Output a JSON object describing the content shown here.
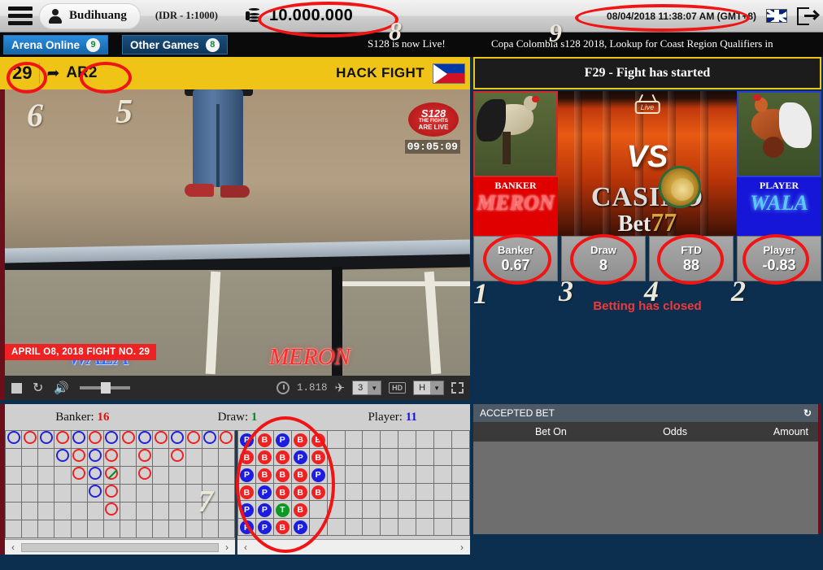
{
  "topbar": {
    "menu_icon": "hamburger-icon",
    "username": "Budihuang",
    "currency": "(IDR - 1:1000)",
    "balance": "10.000.000",
    "timestamp": "08/04/2018 11:38:07 AM (GMT+8)",
    "flag_icon": "uk-flag-icon",
    "logout_icon": "logout-icon"
  },
  "nav": {
    "tabs": [
      {
        "label": "Arena Online",
        "count": "9"
      },
      {
        "label": "Other Games",
        "count": "8"
      }
    ],
    "ticker_left": "S128 is now Live!",
    "ticker_right": "Copa Colombia s128 2018, Lookup for Coast Region Qualifiers in"
  },
  "fight_header": {
    "fight_number": "29",
    "rooster_icon": "rooster-icon",
    "arena_code": "AR2",
    "fight_type": "HACK FIGHT",
    "flag_icon": "philippines-flag-icon"
  },
  "status": {
    "text": "F29 - Fight has started"
  },
  "video": {
    "wala_label": "WALA",
    "meron_label": "MERON",
    "banner": "APRIL O8, 2018 FIGHT NO. 29",
    "logo_line1": "S128",
    "logo_line2": "THE FIGHTS",
    "logo_line3": "ARE LIVE",
    "clock": "09:05:09",
    "controls": {
      "stop_icon": "stop-icon",
      "refresh_icon": "replay-icon",
      "volume_icon": "volume-icon",
      "timer_icon": "timer-icon",
      "bitrate": "1.818",
      "wifi_icon": "wifi-icon",
      "stream_select": "3",
      "hd_badge": "HD",
      "quality_select": "H",
      "fullscreen_icon": "fullscreen-icon"
    }
  },
  "vs_panel": {
    "left": {
      "tag": "BANKER",
      "name": "MERON",
      "photo": "rooster-photo"
    },
    "right": {
      "tag": "PLAYER",
      "name": "WALA",
      "photo": "rooster-photo"
    },
    "vs_text": "VS",
    "live_badge": "Live",
    "brand_line1": "CASINO",
    "brand_line2": "Bet",
    "brand_accent": "77"
  },
  "odds": {
    "buttons": [
      {
        "name": "Banker",
        "value": "0.67"
      },
      {
        "name": "Draw",
        "value": "8"
      },
      {
        "name": "FTD",
        "value": "88"
      },
      {
        "name": "Player",
        "value": "-0.83"
      }
    ],
    "message": "Betting has closed"
  },
  "roads": {
    "stats": [
      {
        "label": "Banker:",
        "value": "16",
        "color": "#e01010"
      },
      {
        "label": "Draw:",
        "value": "1",
        "color": "#0a8a1e"
      },
      {
        "label": "Player:",
        "value": "11",
        "color": "#1515dd"
      }
    ],
    "big_road_cols": 14,
    "big_road_rows": 6,
    "big_road": [
      [
        "P",
        "B",
        "P",
        "B",
        "P",
        "B",
        "P",
        "B",
        "P",
        "B",
        "P",
        "B",
        "P",
        "B"
      ],
      [
        "",
        "",
        "",
        "P",
        "B",
        "P",
        "B",
        "",
        "B",
        "",
        "B",
        "",
        "",
        ""
      ],
      [
        "",
        "",
        "",
        "",
        "B",
        "P",
        "T",
        "",
        "B",
        "",
        "",
        "",
        "",
        ""
      ],
      [
        "",
        "",
        "",
        "",
        "",
        "P",
        "B",
        "",
        "",
        "",
        "",
        "",
        "",
        ""
      ],
      [
        "",
        "",
        "",
        "",
        "",
        "",
        "B",
        "",
        "",
        "",
        "",
        "",
        "",
        ""
      ],
      [
        "",
        "",
        "",
        "",
        "",
        "",
        "",
        "",
        "",
        "",
        "",
        "",
        "",
        ""
      ]
    ],
    "bead_cols": 13,
    "bead_rows": 6,
    "bead_road": [
      [
        "P",
        "B",
        "P",
        "B",
        "B",
        "",
        "",
        "",
        "",
        "",
        "",
        "",
        ""
      ],
      [
        "B",
        "B",
        "B",
        "P",
        "B",
        "",
        "",
        "",
        "",
        "",
        "",
        "",
        ""
      ],
      [
        "P",
        "B",
        "B",
        "B",
        "P",
        "",
        "",
        "",
        "",
        "",
        "",
        "",
        ""
      ],
      [
        "B",
        "P",
        "B",
        "B",
        "B",
        "",
        "",
        "",
        "",
        "",
        "",
        "",
        ""
      ],
      [
        "P",
        "P",
        "T",
        "B",
        "",
        "",
        "",
        "",
        "",
        "",
        "",
        "",
        ""
      ],
      [
        "P",
        "P",
        "B",
        "P",
        "",
        "",
        "",
        "",
        "",
        "",
        "",
        "",
        ""
      ]
    ],
    "scroll_left_icon": "chevron-left-icon",
    "scroll_right_icon": "chevron-right-icon"
  },
  "accepted_bet": {
    "title": "ACCEPTED BET",
    "refresh_icon": "refresh-icon",
    "columns": [
      "Bet On",
      "Odds",
      "Amount"
    ],
    "rows": []
  },
  "annotations": {
    "markers": [
      {
        "n": "1",
        "target": "Banker odds button"
      },
      {
        "n": "2",
        "target": "Player odds button"
      },
      {
        "n": "3",
        "target": "Draw odds button"
      },
      {
        "n": "4",
        "target": "FTD odds button"
      },
      {
        "n": "5",
        "target": "Arena code AR2"
      },
      {
        "n": "6",
        "target": "Fight number 29"
      },
      {
        "n": "7",
        "target": "Road map grid"
      },
      {
        "n": "8",
        "target": "Balance"
      },
      {
        "n": "9",
        "target": "Timestamp"
      }
    ],
    "color": "#f01414"
  }
}
